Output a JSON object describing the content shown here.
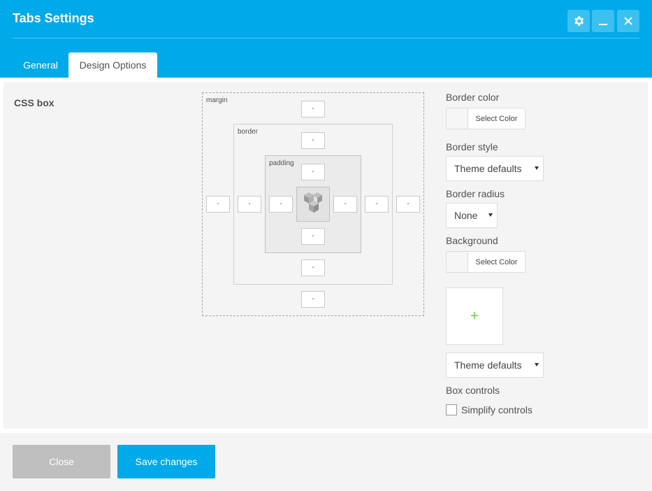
{
  "dialog": {
    "title": "Tabs Settings",
    "tabs": [
      {
        "label": "General",
        "active": false
      },
      {
        "label": "Design Options",
        "active": true
      }
    ],
    "header_buttons": [
      "gear-icon",
      "minimize-icon",
      "close-icon"
    ]
  },
  "css_box": {
    "label": "CSS box",
    "layers": {
      "margin": "margin",
      "border": "border",
      "padding": "padding"
    },
    "placeholder": "-",
    "margin": {
      "top": "-",
      "right": "-",
      "bottom": "-",
      "left": "-"
    },
    "border": {
      "top": "-",
      "right": "-",
      "bottom": "-",
      "left": "-"
    },
    "padding": {
      "top": "-",
      "right": "-",
      "bottom": "-",
      "left": "-"
    },
    "center_icon": "vc-logo-icon"
  },
  "options": {
    "border_color": {
      "label": "Border color",
      "button": "Select Color"
    },
    "border_style": {
      "label": "Border style",
      "value": "Theme defaults"
    },
    "border_radius": {
      "label": "Border radius",
      "value": "None"
    },
    "background": {
      "label": "Background",
      "button": "Select Color"
    },
    "image_add": "+",
    "background_style": {
      "value": "Theme defaults"
    },
    "box_controls": {
      "label": "Box controls",
      "checkbox": "Simplify controls",
      "checked": false
    }
  },
  "footer": {
    "close_label": "Close",
    "save_label": "Save changes"
  },
  "colors": {
    "accent": "#00a9e9",
    "close_button": "#bfbfbf",
    "plus": "#6ac94b"
  }
}
